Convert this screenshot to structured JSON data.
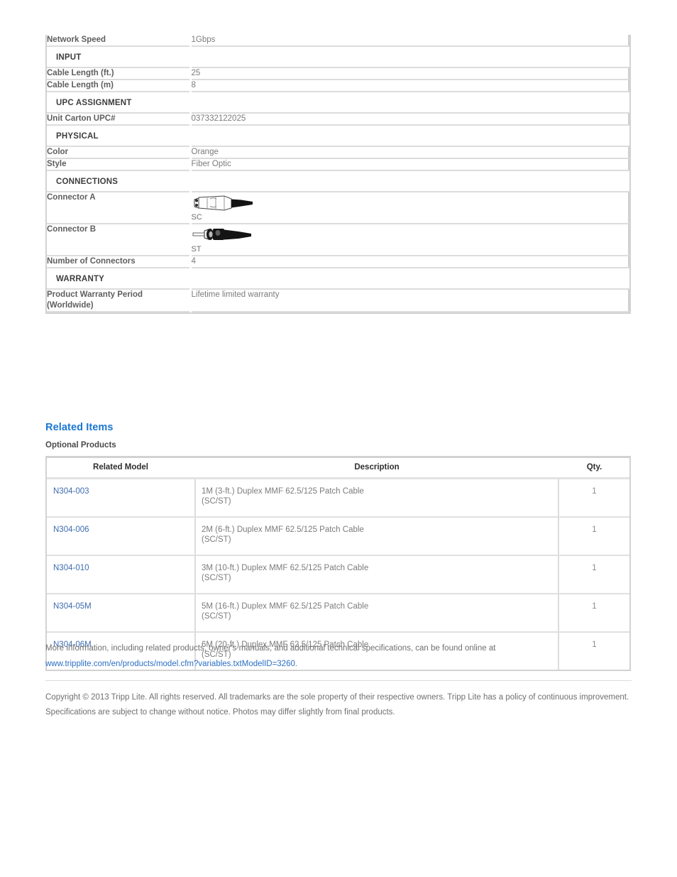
{
  "spec_table": {
    "rows": [
      {
        "kind": "spec",
        "label": "Network Speed",
        "value": "1Gbps"
      },
      {
        "kind": "section",
        "label": "INPUT"
      },
      {
        "kind": "spec",
        "label": "Cable Length (ft.)",
        "value": "25"
      },
      {
        "kind": "spec",
        "label": "Cable Length (m)",
        "value": "8"
      },
      {
        "kind": "section",
        "label": "UPC ASSIGNMENT"
      },
      {
        "kind": "spec",
        "label": "Unit Carton UPC#",
        "value": "037332122025"
      },
      {
        "kind": "section",
        "label": "PHYSICAL"
      },
      {
        "kind": "spec",
        "label": "Color",
        "value": "Orange"
      },
      {
        "kind": "spec",
        "label": "Style",
        "value": "Fiber Optic"
      },
      {
        "kind": "section",
        "label": "CONNECTIONS"
      },
      {
        "kind": "connector",
        "label": "Connector A",
        "value": "SC",
        "icon": "sc-connector-icon"
      },
      {
        "kind": "connector",
        "label": "Connector B",
        "value": "ST",
        "icon": "st-connector-icon"
      },
      {
        "kind": "spec",
        "label": "Number of Connectors",
        "value": "4"
      },
      {
        "kind": "section",
        "label": "WARRANTY"
      },
      {
        "kind": "spec",
        "label": "Product Warranty Period (Worldwide)",
        "value": "Lifetime limited warranty"
      }
    ]
  },
  "related": {
    "heading": "Related Items",
    "subheading": "Optional Products",
    "columns": [
      "Related Model",
      "Description",
      "Qty."
    ],
    "rows": [
      {
        "model": "N304-003",
        "description": "1M (3-ft.) Duplex MMF 62.5/125 Patch Cable (SC/ST)",
        "qty": "1"
      },
      {
        "model": "N304-006",
        "description": "2M (6-ft.) Duplex MMF 62.5/125 Patch Cable (SC/ST)",
        "qty": "1"
      },
      {
        "model": "N304-010",
        "description": "3M (10-ft.) Duplex MMF 62.5/125 Patch Cable (SC/ST)",
        "qty": "1"
      },
      {
        "model": "N304-05M",
        "description": "5M (16-ft.) Duplex MMF 62.5/125 Patch Cable (SC/ST)",
        "qty": "1"
      },
      {
        "model": "N304-06M",
        "description": "6M (20-ft.) Duplex MMF 62.5/125 Patch Cable (SC/ST)",
        "qty": "1"
      }
    ]
  },
  "footer": {
    "more_info_text": "More information, including related products, owner's manuals, and additional technical specifications, can be found online at ",
    "more_info_url_text": "www.tripplite.com/en/products/model.cfm?variables.txtModelID=3260",
    "more_info_period": ".",
    "copyright": "Copyright © 2013 Tripp Lite. All rights reserved. All trademarks are the sole property of their respective owners. Tripp Lite has a policy of continuous improvement. Specifications are subject to change without notice. Photos may differ slightly from final products."
  },
  "colors": {
    "heading_blue": "#1a76d2",
    "link_blue": "#3d6cb0",
    "url_blue": "#2b6fc4",
    "label_gray": "#5e5e5e",
    "value_gray": "#7c7c7c",
    "border_gray": "#d2d2d2"
  }
}
